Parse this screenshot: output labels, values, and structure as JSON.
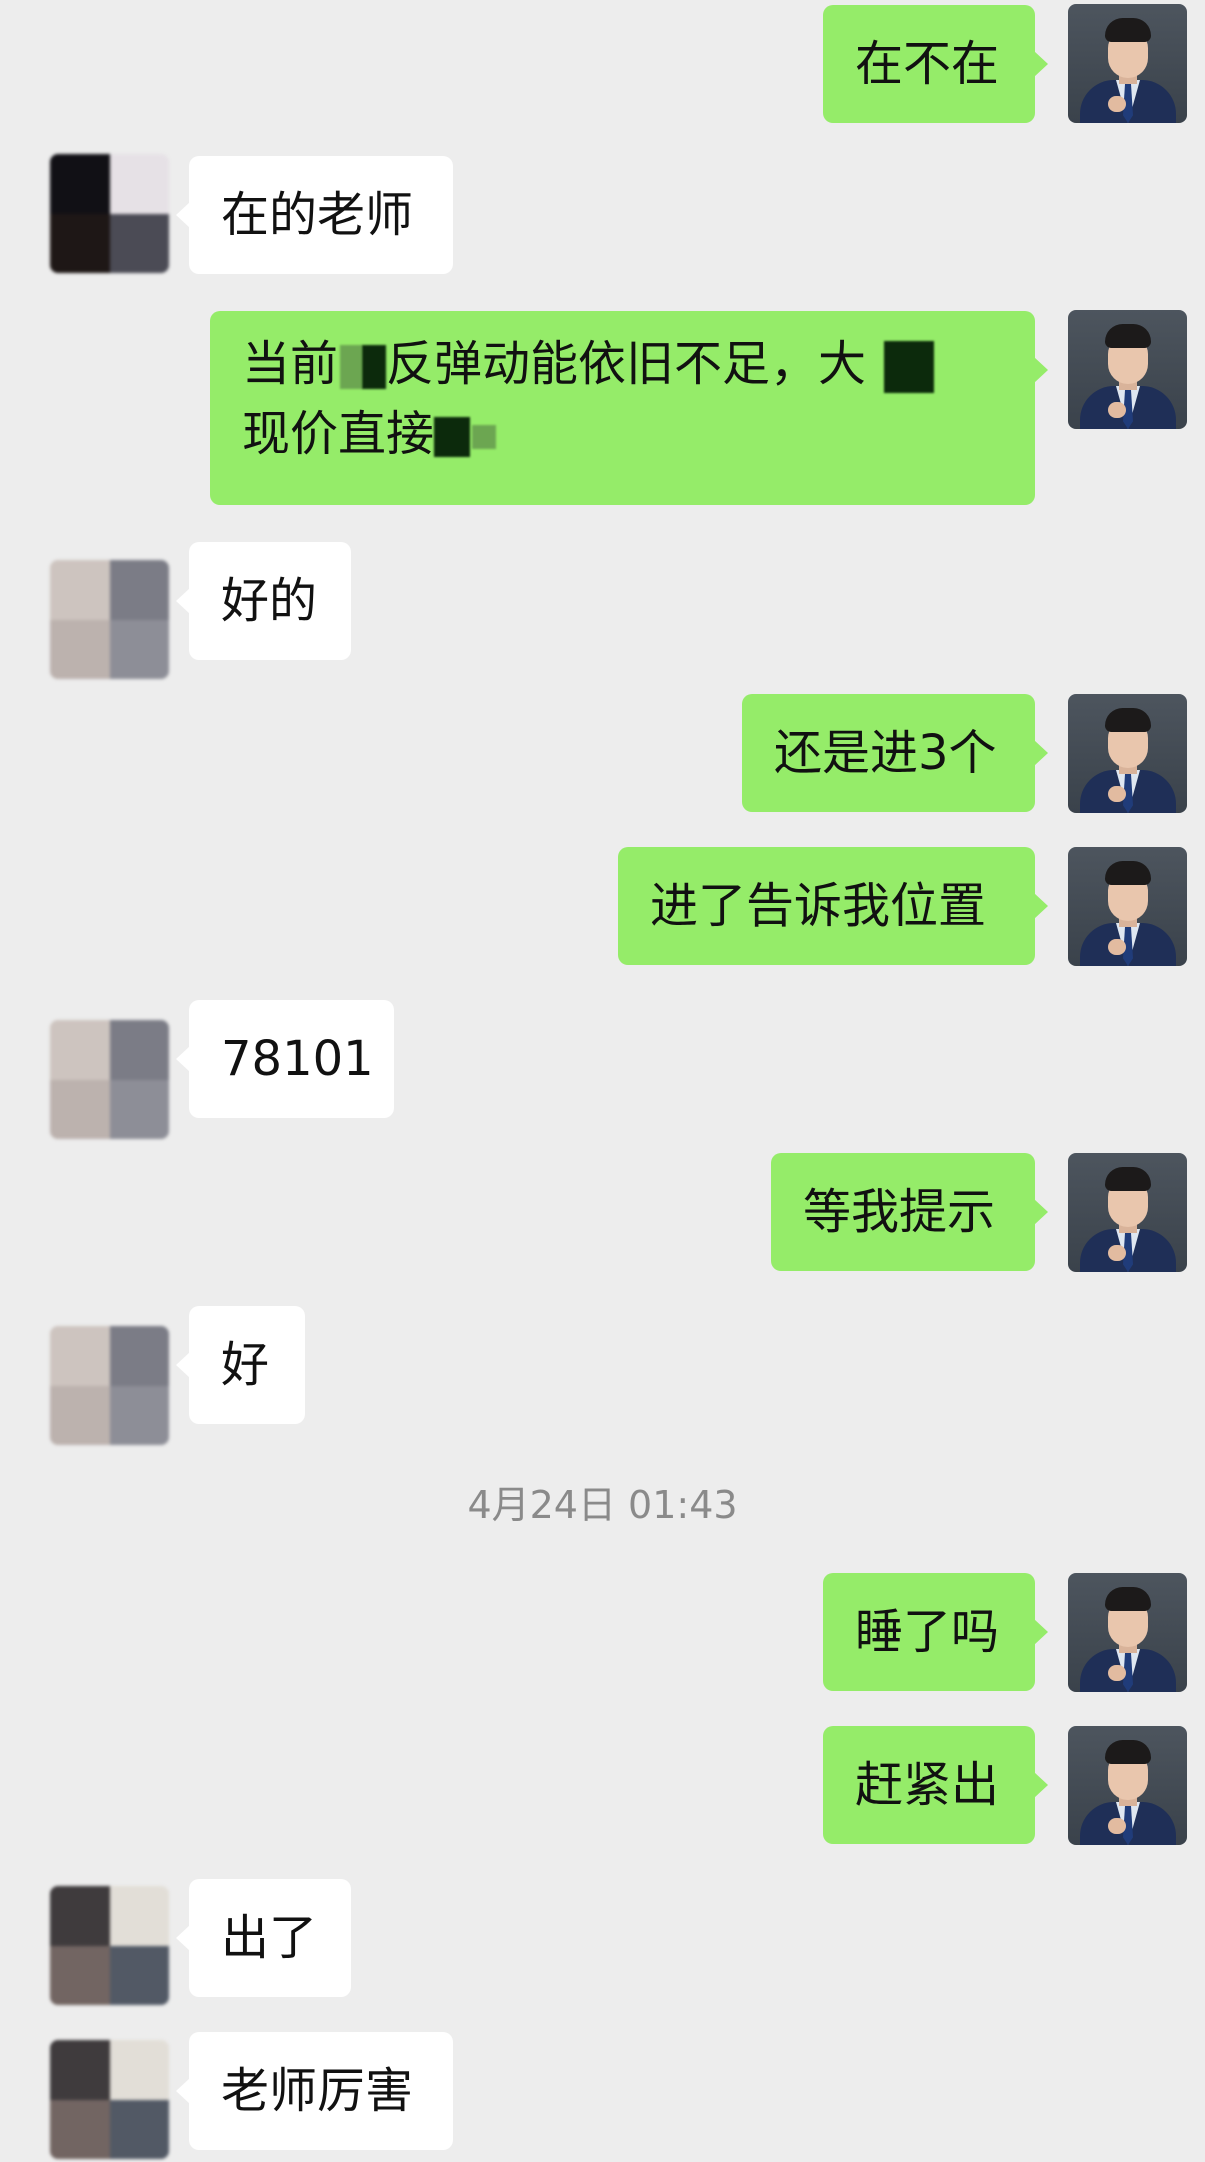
{
  "timestamp": "4月24日 01:43",
  "messages": [
    {
      "id": 1,
      "sender": "me",
      "text": "在不在"
    },
    {
      "id": 2,
      "sender": "contact",
      "text": "在的老师"
    },
    {
      "id": 3,
      "sender": "me",
      "line1_a": "当前",
      "line1_b": "反弹动能依旧不足，大",
      "line2": "现价直接"
    },
    {
      "id": 4,
      "sender": "contact",
      "text": "好的"
    },
    {
      "id": 5,
      "sender": "me",
      "text": "还是进3个"
    },
    {
      "id": 6,
      "sender": "me",
      "text": "进了告诉我位置"
    },
    {
      "id": 7,
      "sender": "contact",
      "text": "78101"
    },
    {
      "id": 8,
      "sender": "me",
      "text": "等我提示"
    },
    {
      "id": 9,
      "sender": "contact",
      "text": "好"
    },
    {
      "id": 10,
      "sender": "me",
      "text": "睡了吗"
    },
    {
      "id": 11,
      "sender": "me",
      "text": "赶紧出"
    },
    {
      "id": 12,
      "sender": "contact",
      "text": "出了"
    },
    {
      "id": 13,
      "sender": "contact",
      "text": "老师厉害"
    }
  ],
  "colors": {
    "background": "#ededed",
    "my_bubble": "#95ec69",
    "contact_bubble": "#ffffff",
    "text": "#111111",
    "timestamp": "#8a8a8a"
  },
  "icons": {
    "my_avatar": "avatar-man-in-suit",
    "contact_avatar": "avatar-pixelated"
  }
}
